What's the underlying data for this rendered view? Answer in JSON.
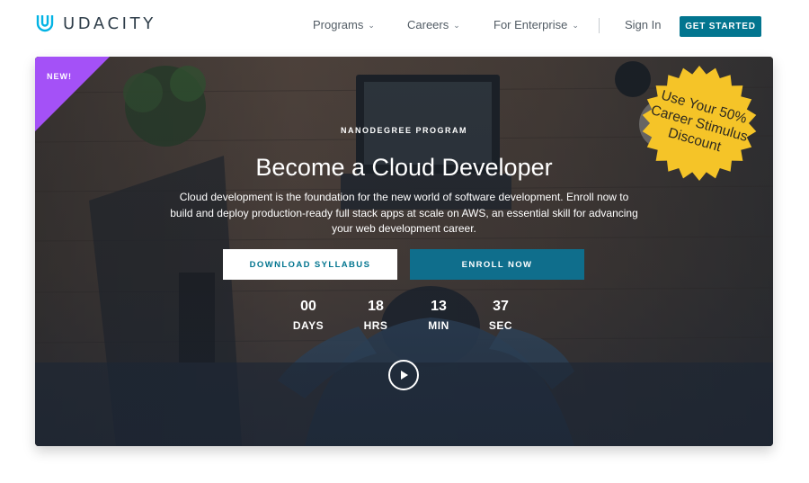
{
  "header": {
    "logo_text": "UDACITY",
    "nav": [
      {
        "label": "Programs",
        "icon": "chevron-down-icon"
      },
      {
        "label": "Careers",
        "icon": "chevron-down-icon"
      },
      {
        "label": "For Enterprise",
        "icon": "chevron-down-icon"
      }
    ],
    "sign_in": "Sign In",
    "get_started": "GET STARTED",
    "colors": {
      "brand": "#02758f",
      "logo": "#2e3d49"
    }
  },
  "hero": {
    "badge": "NEW!",
    "badge_color": "#a451f7",
    "promo": [
      "Use Your 50%",
      "Career Stimulus",
      "Discount"
    ],
    "promo_color": "#f5c428",
    "eyebrow": "NANODEGREE PROGRAM",
    "title": "Become a Cloud Developer",
    "description": "Cloud development is the foundation for the new world of software development. Enroll now to build and deploy production-ready full stack apps at scale on AWS, an essential skill for advancing your web development career.",
    "download_syllabus": "DOWNLOAD SYLLABUS",
    "enroll_now": "ENROLL NOW",
    "countdown": [
      {
        "value": "00",
        "unit": "DAYS"
      },
      {
        "value": "18",
        "unit": "HRS"
      },
      {
        "value": "13",
        "unit": "MIN"
      },
      {
        "value": "37",
        "unit": "SEC"
      }
    ],
    "play_icon": "play-icon"
  }
}
